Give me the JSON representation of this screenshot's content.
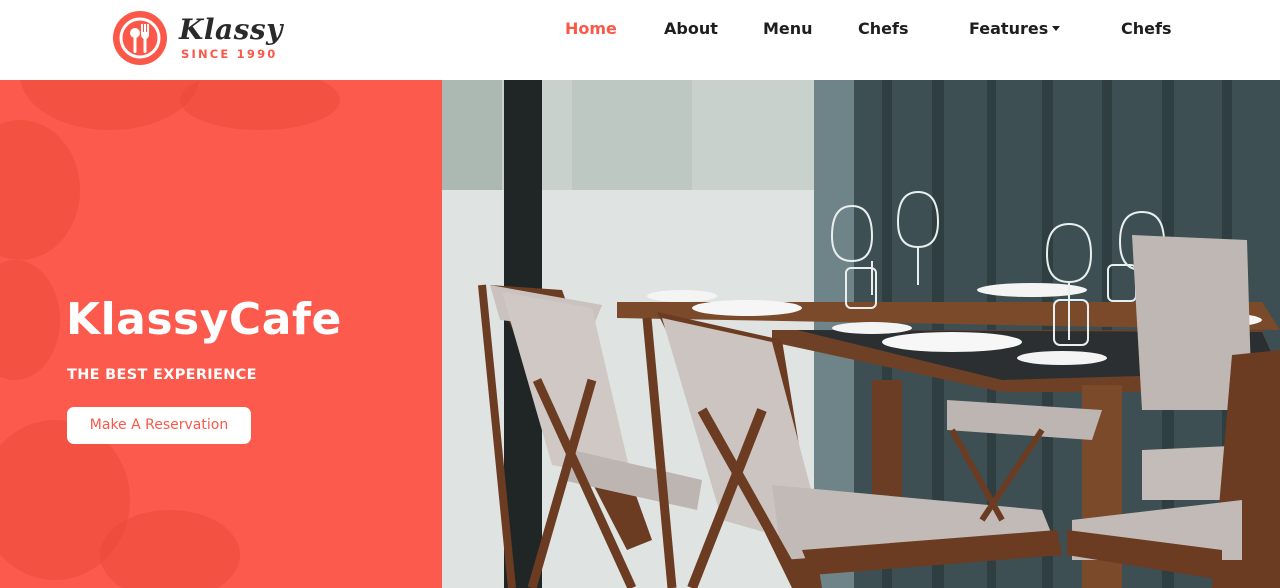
{
  "brand": {
    "name": "Klassy",
    "since": "SINCE 1990",
    "accent": "#fb5849"
  },
  "nav": {
    "items": [
      {
        "label": "Home",
        "active": true
      },
      {
        "label": "About"
      },
      {
        "label": "Menu"
      },
      {
        "label": "Chefs"
      },
      {
        "label": "Features"
      },
      {
        "label": "Chefs"
      }
    ]
  },
  "hero": {
    "title": "KlassyCafe",
    "subtitle": "THE BEST EXPERIENCE",
    "cta_label": "Make A Reservation",
    "panel_color": "#fb5a4c"
  },
  "icons": {
    "logo": "spoon-fork-icon",
    "features_caret": "caret-down-icon"
  }
}
